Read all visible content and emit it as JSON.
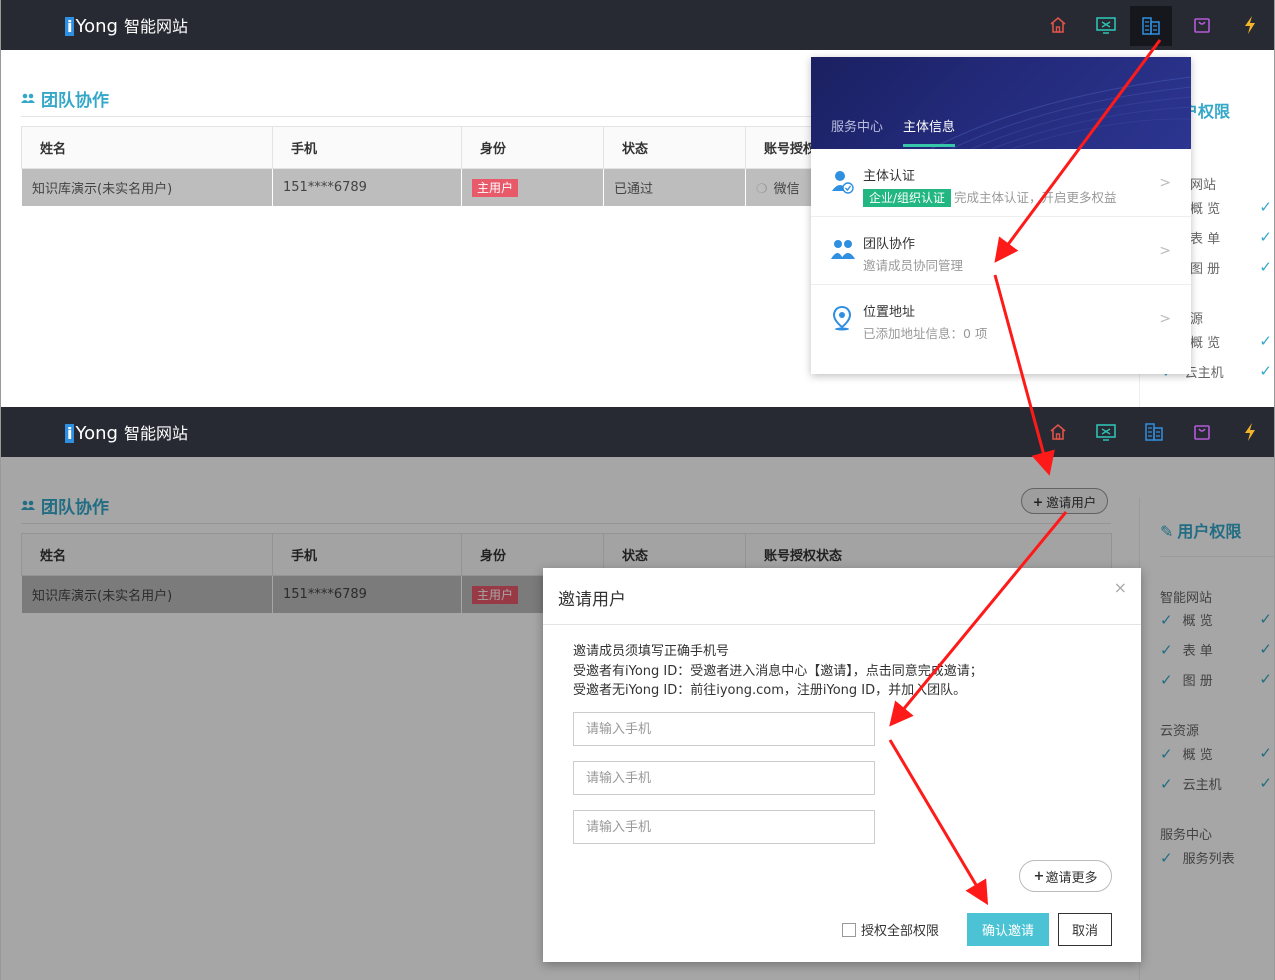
{
  "brand": {
    "i": "i",
    "yong": "Yong",
    "name": "智能网站"
  },
  "nav_icons": [
    "home-icon",
    "monitor-icon",
    "building-icon",
    "bag-icon",
    "lightning-icon"
  ],
  "colors": {
    "topbar": "#272a33",
    "accent": "#35a8c9",
    "badge": "#e85a6a",
    "cert": "#21b682",
    "confirm": "#4cc3d4",
    "arrow": "#ff1a1a"
  },
  "page": {
    "title": "团队协作"
  },
  "table": {
    "headers": [
      "姓名",
      "手机",
      "身份",
      "状态",
      "账号授权状态"
    ],
    "header_truncated": "账号授权",
    "rows": [
      {
        "name": "知识库演示(未实名用户)",
        "phone": "151****6789",
        "role": "主用户",
        "status": "已通过",
        "auth": "微信"
      }
    ]
  },
  "dropdown": {
    "tabs": [
      "服务中心",
      "主体信息"
    ],
    "items": [
      {
        "title": "主体认证",
        "tag": "企业/组织认证",
        "desc": "完成主体认证，开启更多权益"
      },
      {
        "title": "团队协作",
        "desc": "邀请成员协同管理"
      },
      {
        "title": "位置地址",
        "desc": "已添加地址信息：0 项"
      }
    ]
  },
  "rights": {
    "title": "用户权限",
    "title_partial": "户权限",
    "groups": [
      {
        "label": "智能网站",
        "label_partial": "网站",
        "items": [
          "概 览",
          "表 单",
          "图 册"
        ]
      },
      {
        "label": "云资源",
        "label_partial": "源",
        "items": [
          "概 览",
          "云主机"
        ]
      },
      {
        "label": "服务中心",
        "items": [
          "服务列表"
        ]
      }
    ]
  },
  "invite_button": "邀请用户",
  "modal": {
    "title": "邀请用户",
    "close": "×",
    "lines": [
      "邀请成员须填写正确手机号",
      "受邀者有iYong ID：受邀者进入消息中心【邀请】，点击同意完成邀请；",
      "受邀者无iYong ID：前往iyong.com，注册iYong ID，并加入团队。"
    ],
    "phone_placeholder": "请输入手机",
    "more": "邀请更多",
    "auth_all": "授权全部权限",
    "confirm": "确认邀请",
    "cancel": "取消"
  }
}
